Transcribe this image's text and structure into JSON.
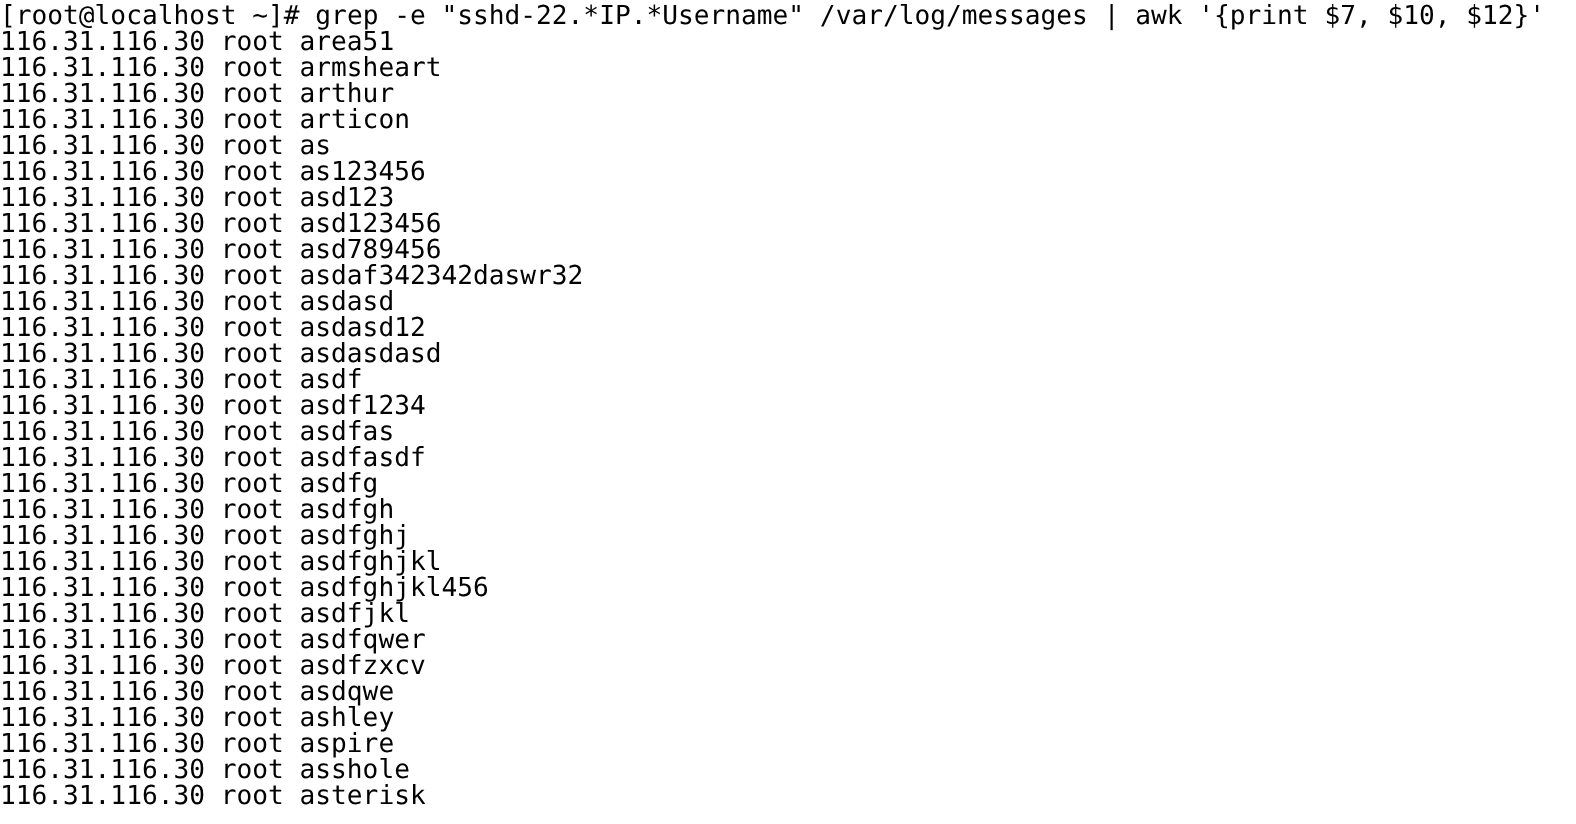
{
  "terminal": {
    "prompt": "[root@localhost ~]#",
    "command": "grep -e \"sshd-22.*IP.*Username\" /var/log/messages | awk '{print $7, $10, $12}'",
    "output_lines": [
      "116.31.116.30 root area51",
      "116.31.116.30 root armsheart",
      "116.31.116.30 root arthur",
      "116.31.116.30 root articon",
      "116.31.116.30 root as",
      "116.31.116.30 root as123456",
      "116.31.116.30 root asd123",
      "116.31.116.30 root asd123456",
      "116.31.116.30 root asd789456",
      "116.31.116.30 root asdaf342342daswr32",
      "116.31.116.30 root asdasd",
      "116.31.116.30 root asdasd12",
      "116.31.116.30 root asdasdasd",
      "116.31.116.30 root asdf",
      "116.31.116.30 root asdf1234",
      "116.31.116.30 root asdfas",
      "116.31.116.30 root asdfasdf",
      "116.31.116.30 root asdfg",
      "116.31.116.30 root asdfgh",
      "116.31.116.30 root asdfghj",
      "116.31.116.30 root asdfghjkl",
      "116.31.116.30 root asdfghjkl456",
      "116.31.116.30 root asdfjkl",
      "116.31.116.30 root asdfqwer",
      "116.31.116.30 root asdfzxcv",
      "116.31.116.30 root asdqwe",
      "116.31.116.30 root ashley",
      "116.31.116.30 root aspire",
      "116.31.116.30 root asshole",
      "116.31.116.30 root asterisk"
    ]
  }
}
